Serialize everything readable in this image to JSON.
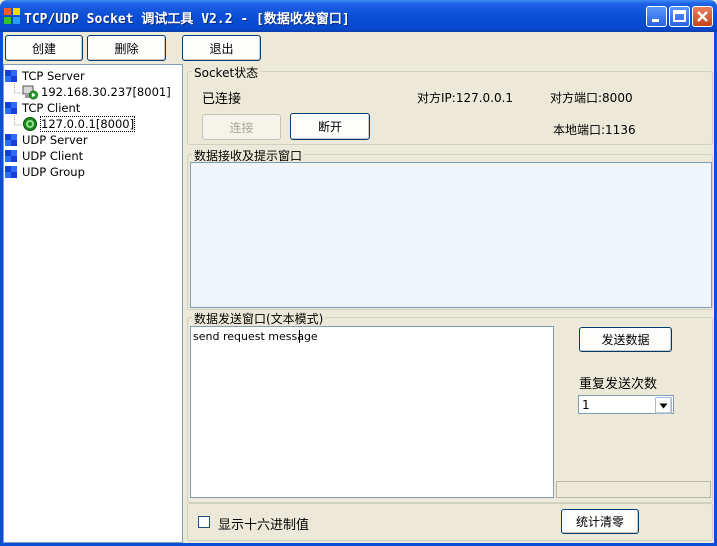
{
  "window": {
    "title": "TCP/UDP Socket 调试工具 V2.2 - [数据收发窗口]"
  },
  "toolbar": {
    "create_label": "创建",
    "delete_label": "删除",
    "exit_label": "退出"
  },
  "tree": {
    "tcp_server": "TCP Server",
    "tcp_server_child": "192.168.30.237[8001]",
    "tcp_client": "TCP Client",
    "tcp_client_child": "127.0.0.1[8000]",
    "udp_server": "UDP Server",
    "udp_client": "UDP Client",
    "udp_group": "UDP Group"
  },
  "socket_status": {
    "group_label": "Socket状态",
    "state": "已连接",
    "remote_ip": "对方IP:127.0.0.1",
    "remote_port": "对方端口:8000",
    "local_port": "本地端口:1136",
    "connect_label": "连接",
    "disconnect_label": "断开"
  },
  "receive": {
    "group_label": "数据接收及提示窗口",
    "content": ""
  },
  "send": {
    "group_label": "数据发送窗口(文本模式)",
    "content": "send request message",
    "send_button_label": "发送数据",
    "repeat_label": "重复发送次数",
    "repeat_value": "1"
  },
  "bottom": {
    "hex_checkbox_label": "显示十六进制值",
    "hex_checked": false,
    "clear_stats_label": "统计清零"
  },
  "colors": {
    "titlebar": "#0a4fd6",
    "panel": "#ece9d8",
    "receive_bg": "#f0f4fb"
  }
}
